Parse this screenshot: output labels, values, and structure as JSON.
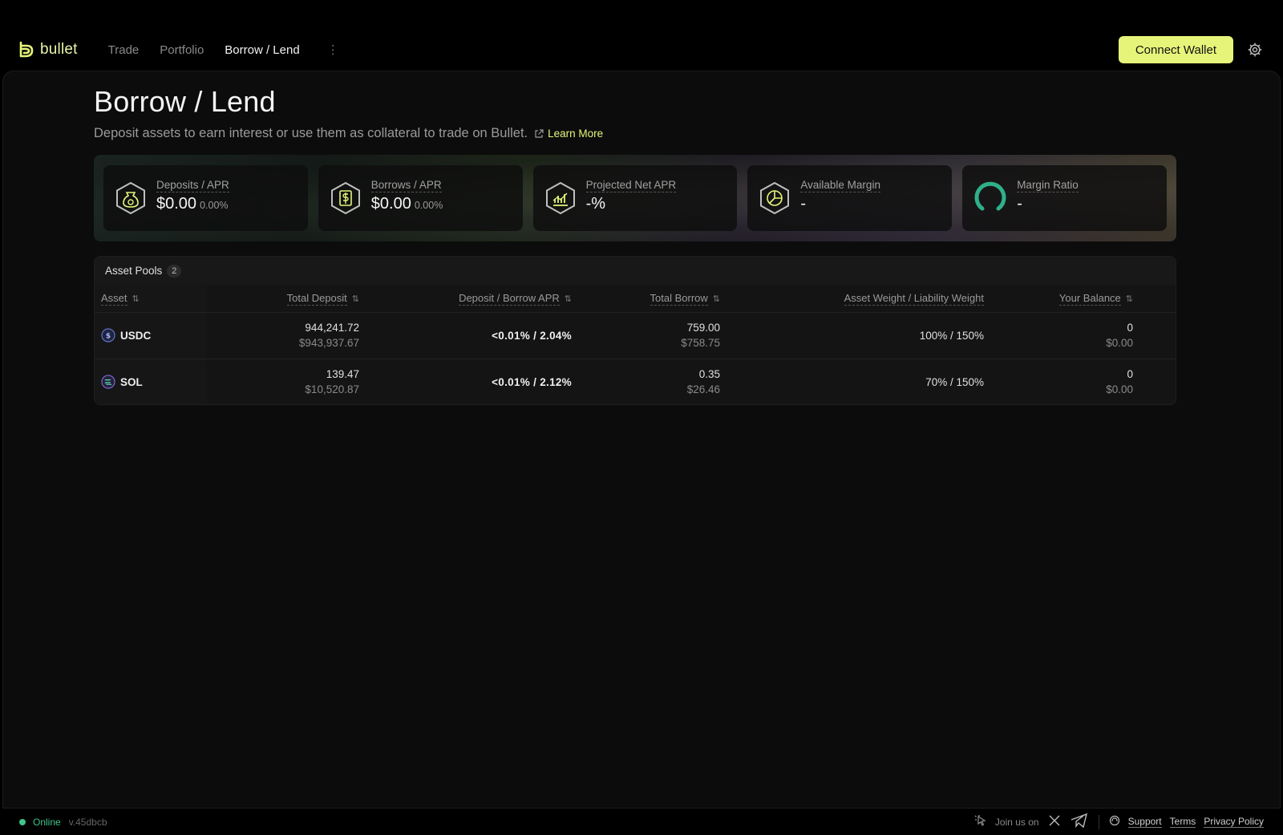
{
  "brand": {
    "name": "bullet",
    "accent": "#e6f57a"
  },
  "nav": {
    "items": [
      {
        "label": "Trade",
        "active": false
      },
      {
        "label": "Portfolio",
        "active": false
      },
      {
        "label": "Borrow / Lend",
        "active": true
      }
    ],
    "more_icon": "vertical-dots-icon"
  },
  "header": {
    "connect_label": "Connect Wallet",
    "settings_icon": "gear-icon"
  },
  "page": {
    "title": "Borrow / Lend",
    "subtitle": "Deposit assets to earn interest or use them as collateral to trade on Bullet.",
    "learn_more": "Learn More"
  },
  "stats": [
    {
      "label": "Deposits / APR",
      "value": "$0.00",
      "sub": "0.00%",
      "icon": "money-bag-icon"
    },
    {
      "label": "Borrows / APR",
      "value": "$0.00",
      "sub": "0.00%",
      "icon": "dollar-bill-icon"
    },
    {
      "label": "Projected Net APR",
      "value": "-%",
      "sub": "",
      "icon": "chart-up-icon"
    },
    {
      "label": "Available Margin",
      "value": "-",
      "sub": "",
      "icon": "pie-chart-icon"
    },
    {
      "label": "Margin Ratio",
      "value": "-",
      "sub": "",
      "icon": "ring-gauge-icon"
    }
  ],
  "pools": {
    "title": "Asset Pools",
    "count": "2",
    "columns": [
      "Asset",
      "Total Deposit",
      "Deposit / Borrow APR",
      "Total Borrow",
      "Asset Weight / Liability Weight",
      "Your Balance"
    ],
    "rows": [
      {
        "asset": "USDC",
        "icon": "usdc-icon",
        "deposit": "944,241.72",
        "deposit_usd": "$943,937.67",
        "apr": "<0.01% / 2.04%",
        "borrow": "759.00",
        "borrow_usd": "$758.75",
        "weights": "100% / 150%",
        "balance": "0",
        "balance_usd": "$0.00"
      },
      {
        "asset": "SOL",
        "icon": "sol-icon",
        "deposit": "139.47",
        "deposit_usd": "$10,520.87",
        "apr": "<0.01% / 2.12%",
        "borrow": "0.35",
        "borrow_usd": "$26.46",
        "weights": "70% / 150%",
        "balance": "0",
        "balance_usd": "$0.00"
      }
    ]
  },
  "footer": {
    "status": "Online",
    "version": "v.45dbcb",
    "join": "Join us on",
    "support": "Support",
    "terms": "Terms",
    "privacy": "Privacy Policy"
  }
}
